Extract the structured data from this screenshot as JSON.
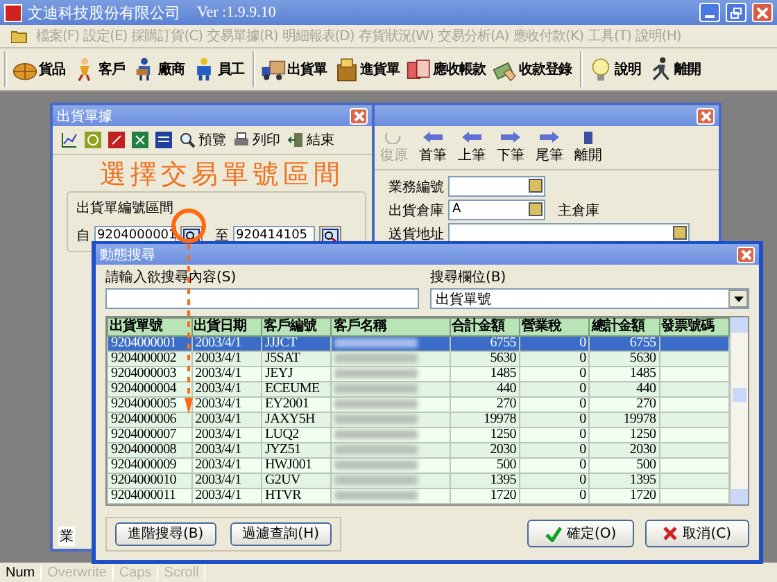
{
  "window": {
    "title": "文迪科技股份有限公司",
    "version": "Ver :1.9.9.10"
  },
  "menu": [
    {
      "label": "檔案(F)",
      "disabled": true
    },
    {
      "label": "設定(E)",
      "disabled": true
    },
    {
      "label": "採購訂貨(C)",
      "disabled": true
    },
    {
      "label": "交易單據(R)",
      "disabled": true
    },
    {
      "label": "明細報表(D)",
      "disabled": true
    },
    {
      "label": "存貨狀況(W)",
      "disabled": true
    },
    {
      "label": "交易分析(A)",
      "disabled": true
    },
    {
      "label": "應收付款(K)",
      "disabled": true
    },
    {
      "label": "工具(T)",
      "disabled": true
    },
    {
      "label": "說明(H)",
      "disabled": true
    }
  ],
  "toolbar": [
    [
      {
        "label": "貨品"
      },
      {
        "label": "客戶"
      },
      {
        "label": "廠商"
      },
      {
        "label": "員工"
      }
    ],
    [
      {
        "label": "出貨單"
      },
      {
        "label": "進貨單"
      },
      {
        "label": "應收帳款"
      },
      {
        "label": "收款登錄"
      }
    ],
    [
      {
        "label": "說明"
      },
      {
        "label": "離開"
      }
    ]
  ],
  "report_window": {
    "title": "出貨單據",
    "toolbar": [
      {
        "label": "預覽"
      },
      {
        "label": "列印"
      },
      {
        "label": "結束"
      }
    ],
    "annotation": "選擇交易單號區間",
    "group_label": "出貨單編號區間",
    "from_label": "自",
    "from_value": "9204000001",
    "to_label": "至",
    "to_value": "920414105",
    "bottom_label": "業"
  },
  "form_window": {
    "toolbar": [
      {
        "label": "復原",
        "disabled": true
      },
      {
        "label": "首筆",
        "disabled": false
      },
      {
        "label": "上筆",
        "disabled": false
      },
      {
        "label": "下筆",
        "disabled": false
      },
      {
        "label": "尾筆",
        "disabled": false
      },
      {
        "label": "離開",
        "disabled": false
      }
    ],
    "fields": [
      {
        "label": "業務編號"
      },
      {
        "label": "出貨倉庫",
        "value": "A",
        "note": "主倉庫"
      },
      {
        "label": "送貨地址"
      }
    ]
  },
  "dialog": {
    "title": "動態搜尋",
    "search_label": "請輸入欲搜尋內容(S)",
    "field_label": "搜尋欄位(B)",
    "field_value": "出貨單號",
    "table": {
      "columns": [
        "出貨單號",
        "出貨日期",
        "客戶編號",
        "客戶名稱",
        "合計金額",
        "營業稅",
        "總計金額",
        "發票號碼"
      ],
      "rows": [
        {
          "selected": true,
          "cells": [
            "9204000001",
            "2003/4/1",
            "JJJCT",
            "",
            "6755",
            "0",
            "6755",
            ""
          ]
        },
        {
          "selected": false,
          "cells": [
            "9204000002",
            "2003/4/1",
            "J5SAT",
            "",
            "5630",
            "0",
            "5630",
            ""
          ]
        },
        {
          "selected": false,
          "cells": [
            "9204000003",
            "2003/4/1",
            "JEYJ",
            "",
            "1485",
            "0",
            "1485",
            ""
          ]
        },
        {
          "selected": false,
          "cells": [
            "9204000004",
            "2003/4/1",
            "ECEUME",
            "",
            "440",
            "0",
            "440",
            ""
          ]
        },
        {
          "selected": false,
          "cells": [
            "9204000005",
            "2003/4/1",
            "EY2001",
            "",
            "270",
            "0",
            "270",
            ""
          ]
        },
        {
          "selected": false,
          "cells": [
            "9204000006",
            "2003/4/1",
            "JAXY5H",
            "",
            "19978",
            "0",
            "19978",
            ""
          ]
        },
        {
          "selected": false,
          "cells": [
            "9204000007",
            "2003/4/1",
            "LUQ2",
            "",
            "1250",
            "0",
            "1250",
            ""
          ]
        },
        {
          "selected": false,
          "cells": [
            "9204000008",
            "2003/4/1",
            "JYZ51",
            "",
            "2030",
            "0",
            "2030",
            ""
          ]
        },
        {
          "selected": false,
          "cells": [
            "9204000009",
            "2003/4/1",
            "HWJ001",
            "",
            "500",
            "0",
            "500",
            ""
          ]
        },
        {
          "selected": false,
          "cells": [
            "9204000010",
            "2003/4/1",
            "G2UV",
            "",
            "1395",
            "0",
            "1395",
            ""
          ]
        },
        {
          "selected": false,
          "cells": [
            "9204000011",
            "2003/4/1",
            "HTVR",
            "",
            "1720",
            "0",
            "1720",
            ""
          ]
        }
      ]
    },
    "buttons": [
      {
        "label": "進階搜尋(B)",
        "kind": "plain"
      },
      {
        "label": "過濾查詢(H)",
        "kind": "plain"
      },
      {
        "label": "確定(O)",
        "kind": "ok"
      },
      {
        "label": "取消(C)",
        "kind": "cancel"
      }
    ]
  },
  "status_bar": [
    {
      "label": "Num",
      "on": true
    },
    {
      "label": "Overwrite",
      "on": false
    },
    {
      "label": "Caps",
      "on": false
    },
    {
      "label": "Scroll",
      "on": false
    }
  ]
}
